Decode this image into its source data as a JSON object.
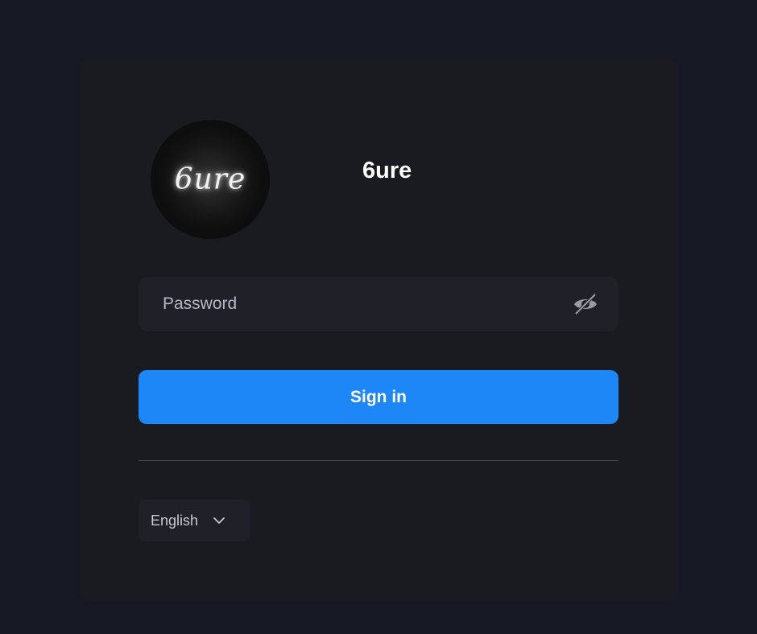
{
  "logo": {
    "text": "6ure",
    "icon": "brand-logo-icon"
  },
  "brand": {
    "title": "6ure"
  },
  "password": {
    "placeholder": "Password",
    "value": "",
    "toggle_icon": "eye-slash-icon"
  },
  "signin": {
    "label": "Sign in"
  },
  "language": {
    "selected": "English",
    "icon": "chevron-down-icon"
  },
  "colors": {
    "page_bg": "#161824",
    "card_bg": "#1a1b21",
    "field_bg": "#1f2028",
    "accent": "#1e87f8"
  }
}
